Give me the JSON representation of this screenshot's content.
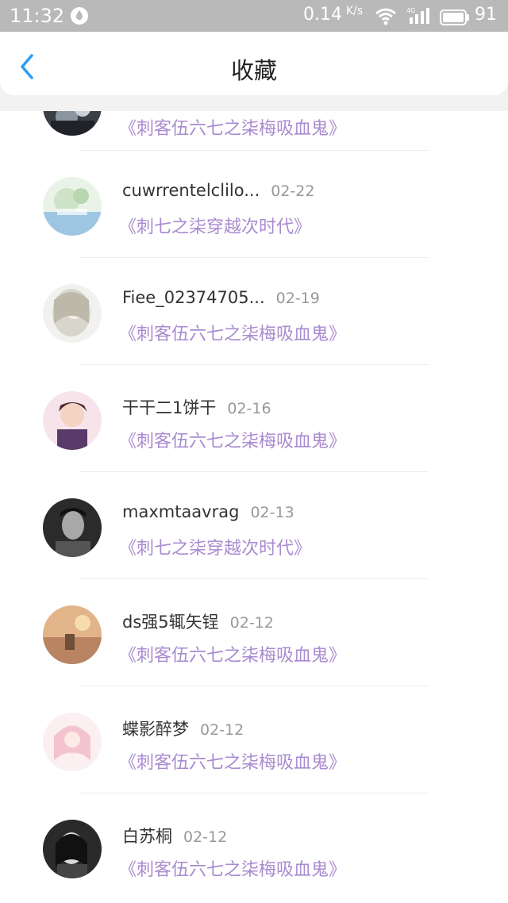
{
  "status_bar": {
    "time": "11:32",
    "network_speed": "0.14",
    "speed_unit": "K/s",
    "network_type": "4G",
    "battery_level": "91"
  },
  "header": {
    "title": "收藏",
    "back_icon": "chevron-left-icon"
  },
  "items": [
    {
      "name": "",
      "date": "",
      "title": "《刺客伍六七之柒梅吸血鬼》"
    },
    {
      "name": "cuwrrentelclilo...",
      "date": "02-22",
      "title": "《刺七之柒穿越次时代》"
    },
    {
      "name": "Fiee_02374705...",
      "date": "02-19",
      "title": "《刺客伍六七之柒梅吸血鬼》"
    },
    {
      "name": "干干二1饼干",
      "date": "02-16",
      "title": "《刺客伍六七之柒梅吸血鬼》"
    },
    {
      "name": "maxmtaavrag",
      "date": "02-13",
      "title": "《刺七之柒穿越次时代》"
    },
    {
      "name": "ds强5辄矢锃",
      "date": "02-12",
      "title": "《刺客伍六七之柒梅吸血鬼》"
    },
    {
      "name": "蝶影醉梦",
      "date": "02-12",
      "title": "《刺客伍六七之柒梅吸血鬼》"
    },
    {
      "name": "白苏桐",
      "date": "02-12",
      "title": "《刺客伍六七之柒梅吸血鬼》"
    }
  ],
  "colors": {
    "accent": "#2a9df4",
    "title_purple": "#a98bd0"
  }
}
